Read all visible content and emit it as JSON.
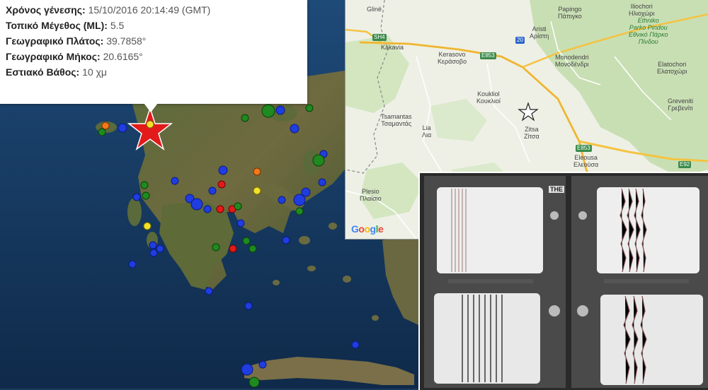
{
  "info": {
    "time_label": "Χρόνος γένεσης:",
    "time_value": "15/10/2016  20:14:49 (GMT)",
    "mag_label": "Τοπικό Μέγεθος (ML):",
    "mag_value": "5.5",
    "lat_label": "Γεωγραφικό Πλάτος:",
    "lat_value": "39.7858°",
    "lon_label": "Γεωγραφικό Μήκος:",
    "lon_value": "20.6165°",
    "depth_label": "Εστιακό Βάθος:",
    "depth_value": "10 χμ"
  },
  "road_map": {
    "places": {
      "gline": "Glinë",
      "kakavia": "Kakavia",
      "kerasovo": [
        "Kerasovo",
        "Κεράσοβο"
      ],
      "papingo": [
        "Papingo",
        "Πάπιγκο"
      ],
      "aristi": [
        "Aristi",
        "Αρίστη"
      ],
      "iliochori": [
        "Iliochori",
        "Ηλιοχώρι"
      ],
      "ethniko_park": [
        "Ethniko",
        "Parko Pindou",
        "Εθνικό Πάρκο",
        "Πίνδου"
      ],
      "monodendri": [
        "Monodendri",
        "Μονοδένδρι"
      ],
      "elatochori": [
        "Elatochori",
        "Ελατοχώρι"
      ],
      "koukliol": [
        "Koukliol",
        "Κουκλιοί"
      ],
      "tsamantas": [
        "Tsamantas",
        "Τσαμαντάς"
      ],
      "lia": [
        "Lia",
        "Λια"
      ],
      "zitsa": [
        "Zitsa",
        "Ζίτσα"
      ],
      "greveniti": [
        "Greveniti",
        "Γρεβενίτι"
      ],
      "eleousa": [
        "Eleousa",
        "Ελεούσα"
      ],
      "plesio": [
        "Plesio",
        "Πλαίσιο"
      ]
    },
    "shields": {
      "sh4": "SH4",
      "e853a": "E853",
      "r20": "20",
      "e853b": "E853",
      "e92": "E92"
    },
    "google": [
      "G",
      "o",
      "o",
      "g",
      "l",
      "e"
    ],
    "google_colors": [
      "#4285F4",
      "#EA4335",
      "#FBBC05",
      "#4285F4",
      "#34A853",
      "#EA4335"
    ]
  },
  "seismograph": {
    "label": "THE"
  },
  "legend_colors": {
    "blue": "#1f3de0",
    "green": "#1f8a1f",
    "orange": "#f07a1a",
    "red": "#e21a1a",
    "yellow": "#f2e22a",
    "star": "#e21a1a"
  }
}
